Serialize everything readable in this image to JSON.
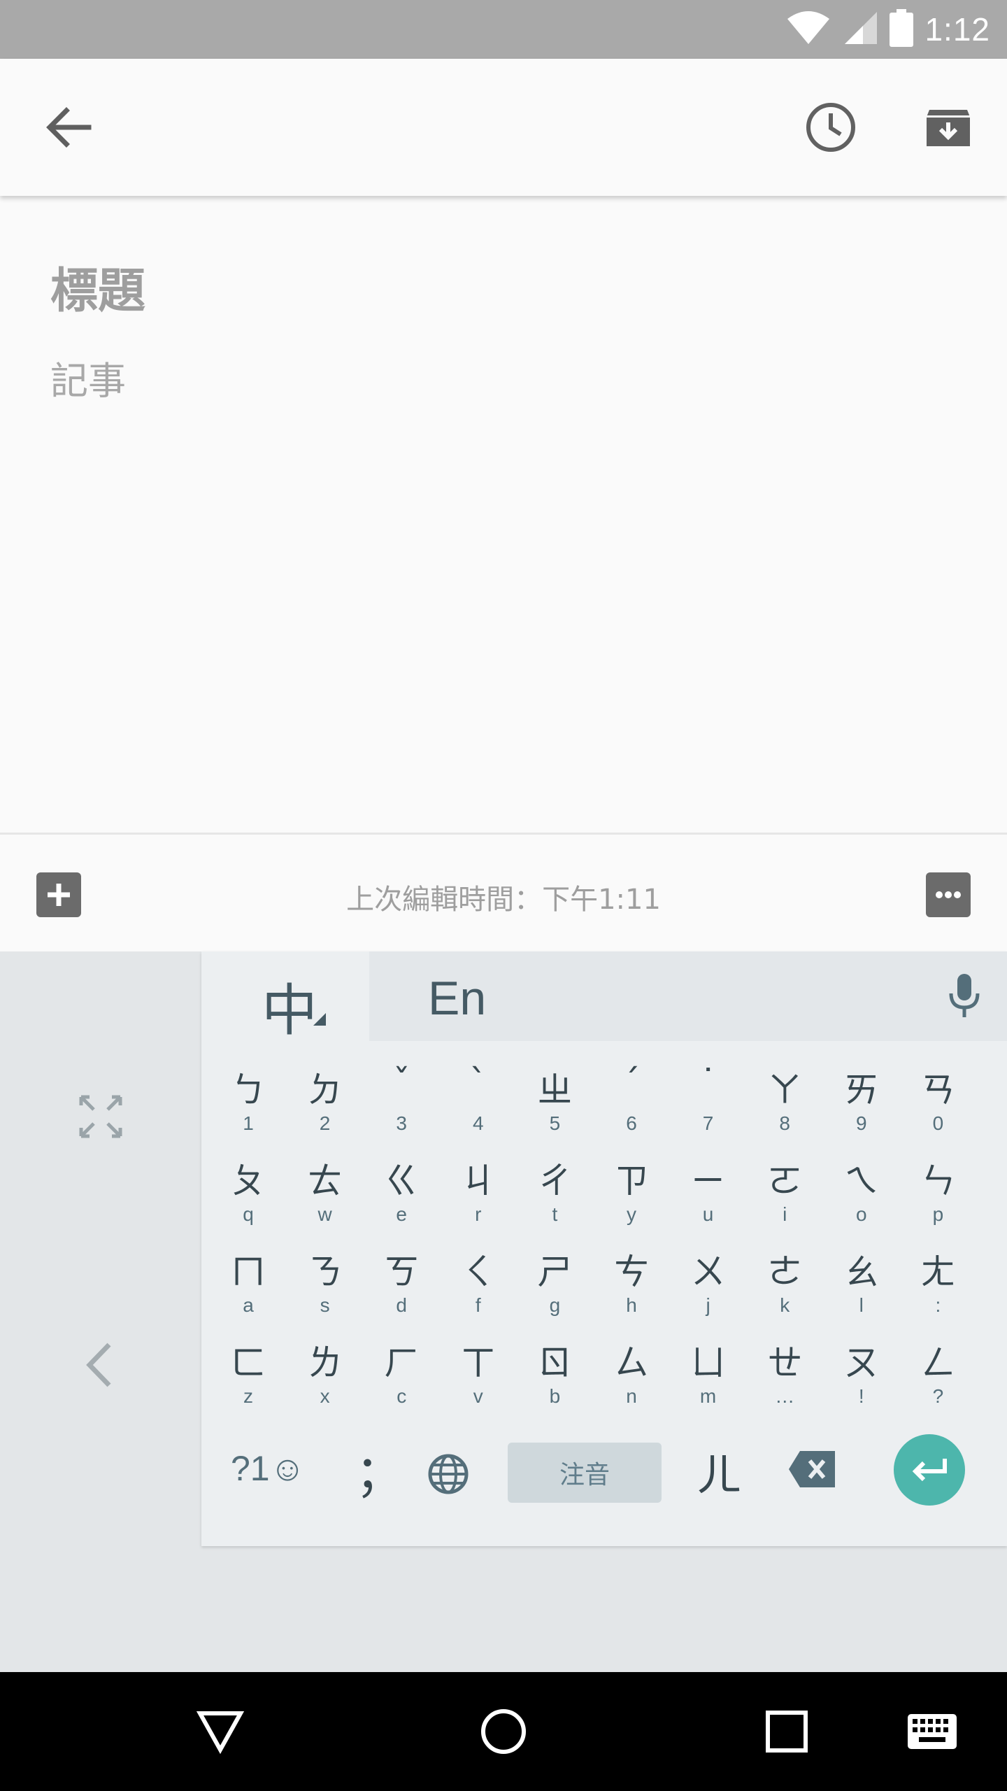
{
  "status_bar": {
    "time": "1:12"
  },
  "note": {
    "title_placeholder": "標題",
    "body_placeholder": "記事",
    "edit_time": "上次編輯時間：下午1:11"
  },
  "keyboard": {
    "zh_label": "中",
    "en_label": "En",
    "row1": [
      {
        "main": "ㄅ",
        "sub": "1"
      },
      {
        "main": "ㄉ",
        "sub": "2"
      },
      {
        "main": "ˇ",
        "sub": "3"
      },
      {
        "main": "ˋ",
        "sub": "4"
      },
      {
        "main": "ㄓ",
        "sub": "5"
      },
      {
        "main": "ˊ",
        "sub": "6"
      },
      {
        "main": "˙",
        "sub": "7"
      },
      {
        "main": "ㄚ",
        "sub": "8"
      },
      {
        "main": "ㄞ",
        "sub": "9"
      },
      {
        "main": "ㄢ",
        "sub": "0"
      }
    ],
    "row2": [
      {
        "main": "ㄆ",
        "sub": "q"
      },
      {
        "main": "ㄊ",
        "sub": "w"
      },
      {
        "main": "ㄍ",
        "sub": "e"
      },
      {
        "main": "ㄐ",
        "sub": "r"
      },
      {
        "main": "ㄔ",
        "sub": "t"
      },
      {
        "main": "ㄗ",
        "sub": "y"
      },
      {
        "main": "ㄧ",
        "sub": "u"
      },
      {
        "main": "ㄛ",
        "sub": "i"
      },
      {
        "main": "ㄟ",
        "sub": "o"
      },
      {
        "main": "ㄣ",
        "sub": "p"
      }
    ],
    "row3": [
      {
        "main": "ㄇ",
        "sub": "a"
      },
      {
        "main": "ㄋ",
        "sub": "s"
      },
      {
        "main": "ㄎ",
        "sub": "d"
      },
      {
        "main": "ㄑ",
        "sub": "f"
      },
      {
        "main": "ㄕ",
        "sub": "g"
      },
      {
        "main": "ㄘ",
        "sub": "h"
      },
      {
        "main": "ㄨ",
        "sub": "j"
      },
      {
        "main": "ㄜ",
        "sub": "k"
      },
      {
        "main": "ㄠ",
        "sub": "l"
      },
      {
        "main": "ㄤ",
        "sub": ":"
      }
    ],
    "row4": [
      {
        "main": "ㄈ",
        "sub": "z"
      },
      {
        "main": "ㄌ",
        "sub": "x"
      },
      {
        "main": "ㄏ",
        "sub": "c"
      },
      {
        "main": "ㄒ",
        "sub": "v"
      },
      {
        "main": "ㄖ",
        "sub": "b"
      },
      {
        "main": "ㄙ",
        "sub": "n"
      },
      {
        "main": "ㄩ",
        "sub": "m"
      },
      {
        "main": "ㄝ",
        "sub": "…"
      },
      {
        "main": "ㄡ",
        "sub": "!"
      },
      {
        "main": "ㄥ",
        "sub": "?"
      }
    ],
    "symbols_label": "?1☺",
    "semicolon_label": "；",
    "space_label": "注音",
    "er_label": "ㄦ"
  },
  "colors": {
    "accent": "#4db6ac",
    "status_bar": "#a9a9a9",
    "keyboard_bg": "#eceff1"
  }
}
